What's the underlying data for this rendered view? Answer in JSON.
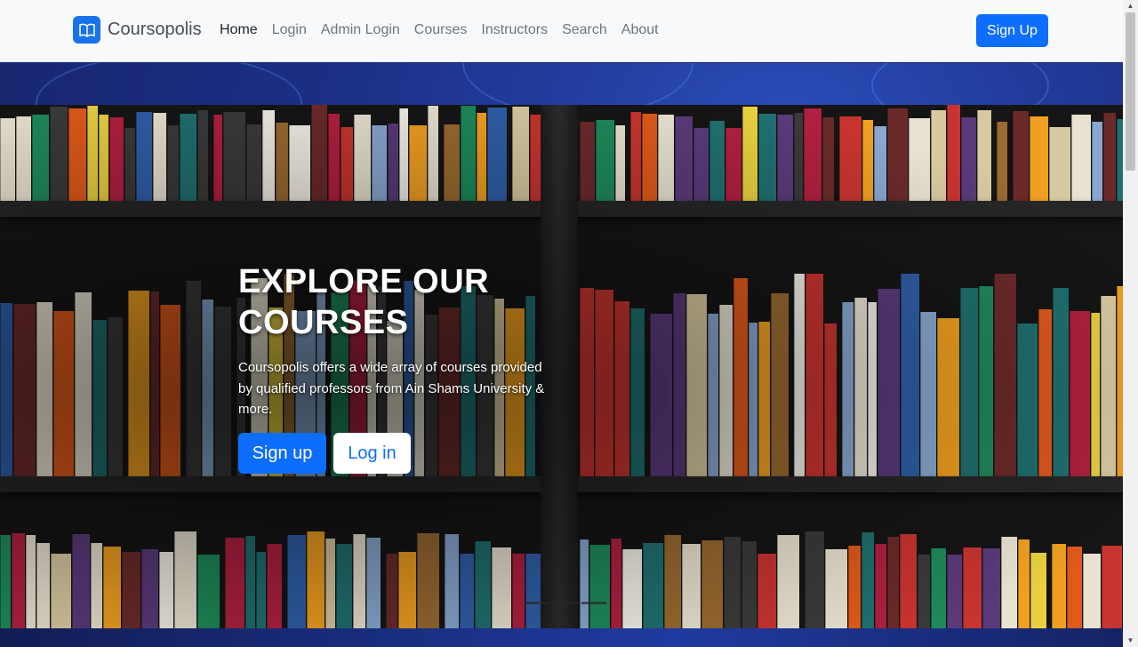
{
  "brand": {
    "name": "Coursopolis",
    "logo_icon": "book-open-icon"
  },
  "nav": {
    "links": [
      "Home",
      "Login",
      "Admin Login",
      "Courses",
      "Instructors",
      "Search",
      "About"
    ],
    "active": "Home",
    "signup_label": "Sign Up"
  },
  "hero": {
    "title": "EXPLORE OUR COURSES",
    "description": "Coursopolis offers a wide array of courses provided by qualified professors from Ain Shams University & more.",
    "primary_button": "Sign up",
    "secondary_button": "Log in"
  },
  "colors": {
    "accent": "#0d6efd",
    "navbar_bg": "#f8f9fa",
    "banner_bg": "#1c2f86"
  }
}
